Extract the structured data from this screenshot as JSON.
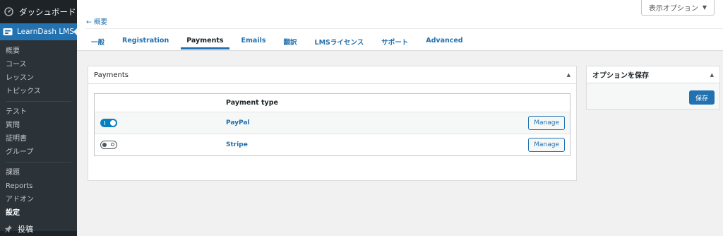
{
  "sidebar": {
    "dashboard_label": "ダッシュボード",
    "active_label": "LearnDash LMS",
    "sub_items": [
      "概要",
      "コース",
      "レッスン",
      "トピックス",
      "テスト",
      "質問",
      "証明書",
      "グループ",
      "課題",
      "Reports",
      "アドオン",
      "設定"
    ],
    "current_item": "設定",
    "bottom_label": "投稿"
  },
  "header": {
    "screen_options_label": "表示オプション",
    "back_link": "← 概要",
    "tabs": [
      {
        "label": "一般",
        "active": false
      },
      {
        "label": "Registration",
        "active": false
      },
      {
        "label": "Payments",
        "active": true
      },
      {
        "label": "Emails",
        "active": false
      },
      {
        "label": "翻訳",
        "active": false
      },
      {
        "label": "LMSライセンス",
        "active": false
      },
      {
        "label": "サポート",
        "active": false
      },
      {
        "label": "Advanced",
        "active": false
      }
    ]
  },
  "payments": {
    "title": "Payments",
    "column_header": "Payment type",
    "rows": [
      {
        "name": "PayPal",
        "enabled": true,
        "action_label": "Manage"
      },
      {
        "name": "Stripe",
        "enabled": false,
        "action_label": "Manage"
      }
    ]
  },
  "save_box": {
    "title": "オプションを保存",
    "button_label": "保存"
  },
  "colors": {
    "sidebar_bg": "#1d2327",
    "accent": "#2271b1",
    "page_bg": "#f1f1f1"
  }
}
